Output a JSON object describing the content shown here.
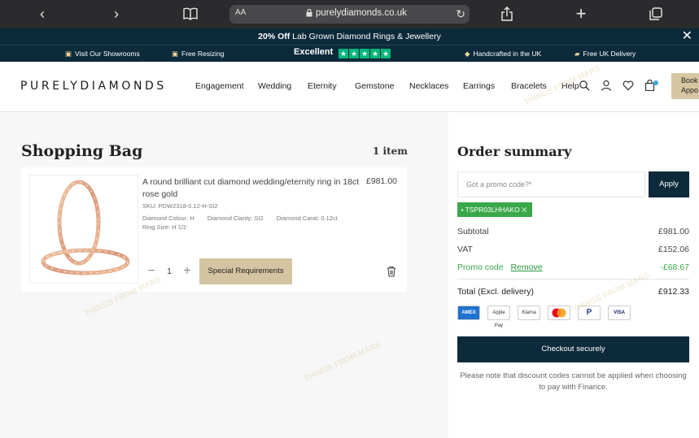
{
  "browser": {
    "text_size": "AA",
    "url": "purelydiamonds.co.uk"
  },
  "promo": {
    "highlight": "20% Off",
    "text": " Lab Grown Diamond Rings & Jewellery"
  },
  "infobar": {
    "showrooms": "Visit Our Showrooms",
    "resizing": "Free Resizing",
    "rating": "Excellent",
    "handcrafted": "Handcrafted in the UK",
    "delivery": "Free UK Delivery"
  },
  "nav": {
    "logo": "PURELYDIAMONDS",
    "links": [
      "Engagement",
      "Wedding",
      "Eternity",
      "Gemstone",
      "Necklaces",
      "Earrings",
      "Bracelets",
      "Help"
    ],
    "book_label_1": "Book",
    "book_label_2": "Appo"
  },
  "bag": {
    "title": "Shopping Bag",
    "count": "1 item",
    "item": {
      "name": "A round brilliant cut diamond wedding/eternity ring in 18ct rose gold",
      "price": "£981.00",
      "sku": "SKU: PDW2318-0.12-H-SI2",
      "colour": "Diamond Colour: H",
      "clarity": "Diamond Clarity: SI2",
      "carat": "Diamond Carat: 0.12ct",
      "ring_size": "Ring Size: H 1/2",
      "quantity": "1",
      "special_label": "Special Requirements"
    }
  },
  "summary": {
    "title": "Order summary",
    "promo_placeholder": "Got a promo code?*",
    "apply_label": "Apply",
    "promo_code": "TSPR03LHHAKO",
    "subtotal_label": "Subtotal",
    "subtotal_value": "£981.00",
    "vat_label": "VAT",
    "vat_value": "£152.06",
    "promo_label": "Promo code",
    "remove_label": "Remove",
    "promo_value": "-£68.67",
    "total_label": "Total (Excl. delivery)",
    "total_value": "£912.33",
    "payment_methods": [
      "AMEX",
      "Apple Pay",
      "Klarna",
      "Mastercard",
      "PayPal",
      "VISA"
    ],
    "checkout_label": "Checkout securely",
    "note": "Please note that discount codes cannot be applied when choosing to pay with Finance."
  },
  "colors": {
    "navy": "#0d2a3b",
    "gold": "#d5c4a1",
    "green": "#3aa84a",
    "trustpilot": "#00b67a"
  }
}
